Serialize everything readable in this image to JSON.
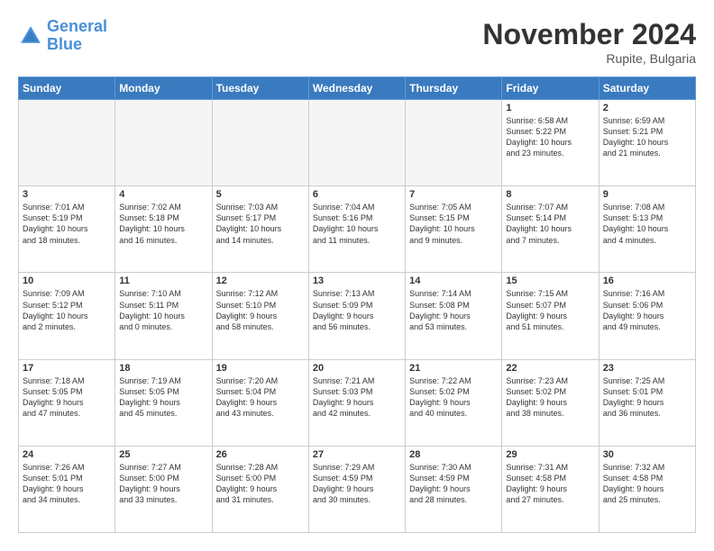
{
  "header": {
    "logo_general": "General",
    "logo_blue": "Blue",
    "month_title": "November 2024",
    "location": "Rupite, Bulgaria"
  },
  "weekdays": [
    "Sunday",
    "Monday",
    "Tuesday",
    "Wednesday",
    "Thursday",
    "Friday",
    "Saturday"
  ],
  "weeks": [
    [
      {
        "day": "",
        "info": ""
      },
      {
        "day": "",
        "info": ""
      },
      {
        "day": "",
        "info": ""
      },
      {
        "day": "",
        "info": ""
      },
      {
        "day": "",
        "info": ""
      },
      {
        "day": "1",
        "info": "Sunrise: 6:58 AM\nSunset: 5:22 PM\nDaylight: 10 hours\nand 23 minutes."
      },
      {
        "day": "2",
        "info": "Sunrise: 6:59 AM\nSunset: 5:21 PM\nDaylight: 10 hours\nand 21 minutes."
      }
    ],
    [
      {
        "day": "3",
        "info": "Sunrise: 7:01 AM\nSunset: 5:19 PM\nDaylight: 10 hours\nand 18 minutes."
      },
      {
        "day": "4",
        "info": "Sunrise: 7:02 AM\nSunset: 5:18 PM\nDaylight: 10 hours\nand 16 minutes."
      },
      {
        "day": "5",
        "info": "Sunrise: 7:03 AM\nSunset: 5:17 PM\nDaylight: 10 hours\nand 14 minutes."
      },
      {
        "day": "6",
        "info": "Sunrise: 7:04 AM\nSunset: 5:16 PM\nDaylight: 10 hours\nand 11 minutes."
      },
      {
        "day": "7",
        "info": "Sunrise: 7:05 AM\nSunset: 5:15 PM\nDaylight: 10 hours\nand 9 minutes."
      },
      {
        "day": "8",
        "info": "Sunrise: 7:07 AM\nSunset: 5:14 PM\nDaylight: 10 hours\nand 7 minutes."
      },
      {
        "day": "9",
        "info": "Sunrise: 7:08 AM\nSunset: 5:13 PM\nDaylight: 10 hours\nand 4 minutes."
      }
    ],
    [
      {
        "day": "10",
        "info": "Sunrise: 7:09 AM\nSunset: 5:12 PM\nDaylight: 10 hours\nand 2 minutes."
      },
      {
        "day": "11",
        "info": "Sunrise: 7:10 AM\nSunset: 5:11 PM\nDaylight: 10 hours\nand 0 minutes."
      },
      {
        "day": "12",
        "info": "Sunrise: 7:12 AM\nSunset: 5:10 PM\nDaylight: 9 hours\nand 58 minutes."
      },
      {
        "day": "13",
        "info": "Sunrise: 7:13 AM\nSunset: 5:09 PM\nDaylight: 9 hours\nand 56 minutes."
      },
      {
        "day": "14",
        "info": "Sunrise: 7:14 AM\nSunset: 5:08 PM\nDaylight: 9 hours\nand 53 minutes."
      },
      {
        "day": "15",
        "info": "Sunrise: 7:15 AM\nSunset: 5:07 PM\nDaylight: 9 hours\nand 51 minutes."
      },
      {
        "day": "16",
        "info": "Sunrise: 7:16 AM\nSunset: 5:06 PM\nDaylight: 9 hours\nand 49 minutes."
      }
    ],
    [
      {
        "day": "17",
        "info": "Sunrise: 7:18 AM\nSunset: 5:05 PM\nDaylight: 9 hours\nand 47 minutes."
      },
      {
        "day": "18",
        "info": "Sunrise: 7:19 AM\nSunset: 5:05 PM\nDaylight: 9 hours\nand 45 minutes."
      },
      {
        "day": "19",
        "info": "Sunrise: 7:20 AM\nSunset: 5:04 PM\nDaylight: 9 hours\nand 43 minutes."
      },
      {
        "day": "20",
        "info": "Sunrise: 7:21 AM\nSunset: 5:03 PM\nDaylight: 9 hours\nand 42 minutes."
      },
      {
        "day": "21",
        "info": "Sunrise: 7:22 AM\nSunset: 5:02 PM\nDaylight: 9 hours\nand 40 minutes."
      },
      {
        "day": "22",
        "info": "Sunrise: 7:23 AM\nSunset: 5:02 PM\nDaylight: 9 hours\nand 38 minutes."
      },
      {
        "day": "23",
        "info": "Sunrise: 7:25 AM\nSunset: 5:01 PM\nDaylight: 9 hours\nand 36 minutes."
      }
    ],
    [
      {
        "day": "24",
        "info": "Sunrise: 7:26 AM\nSunset: 5:01 PM\nDaylight: 9 hours\nand 34 minutes."
      },
      {
        "day": "25",
        "info": "Sunrise: 7:27 AM\nSunset: 5:00 PM\nDaylight: 9 hours\nand 33 minutes."
      },
      {
        "day": "26",
        "info": "Sunrise: 7:28 AM\nSunset: 5:00 PM\nDaylight: 9 hours\nand 31 minutes."
      },
      {
        "day": "27",
        "info": "Sunrise: 7:29 AM\nSunset: 4:59 PM\nDaylight: 9 hours\nand 30 minutes."
      },
      {
        "day": "28",
        "info": "Sunrise: 7:30 AM\nSunset: 4:59 PM\nDaylight: 9 hours\nand 28 minutes."
      },
      {
        "day": "29",
        "info": "Sunrise: 7:31 AM\nSunset: 4:58 PM\nDaylight: 9 hours\nand 27 minutes."
      },
      {
        "day": "30",
        "info": "Sunrise: 7:32 AM\nSunset: 4:58 PM\nDaylight: 9 hours\nand 25 minutes."
      }
    ]
  ]
}
